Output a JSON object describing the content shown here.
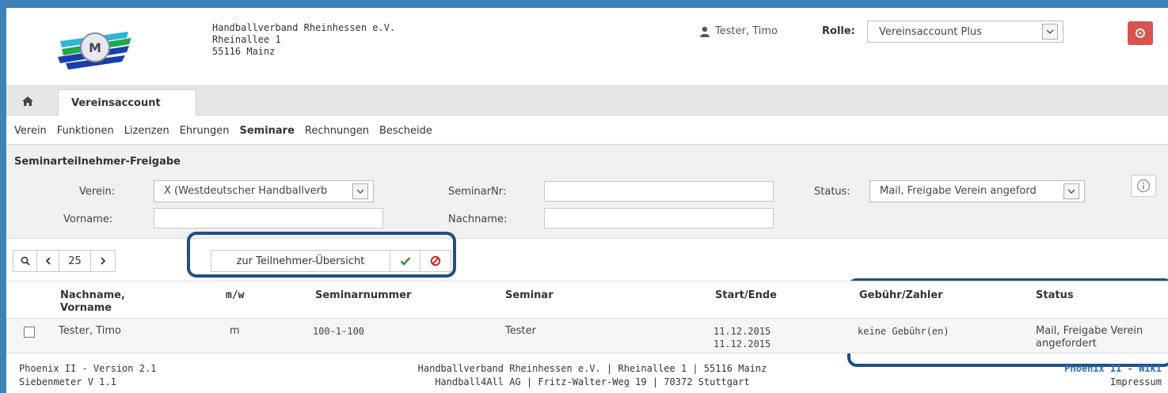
{
  "header": {
    "org_name": "Handballverband Rheinhessen e.V.",
    "org_street": "Rheinallee 1",
    "org_city": "55116 Mainz",
    "user_name": "Tester, Timo",
    "role_label": "Rolle:",
    "role_value": "Vereinsaccount Plus"
  },
  "tabs": {
    "active_label": "Vereinsaccount"
  },
  "submenu": [
    "Verein",
    "Funktionen",
    "Lizenzen",
    "Ehrungen",
    "Seminare",
    "Rechnungen",
    "Bescheide"
  ],
  "submenu_active": "Seminare",
  "filter": {
    "title": "Seminarteilnehmer-Freigabe",
    "verein_label": "Verein:",
    "verein_value": "X (Westdeutscher Handballverb",
    "seminarnr_label": "SeminarNr:",
    "seminarnr_value": "",
    "status_label": "Status:",
    "status_value": "Mail, Freigabe Verein angeford",
    "vorname_label": "Vorname:",
    "vorname_value": "",
    "nachname_label": "Nachname:",
    "nachname_value": ""
  },
  "toolbar": {
    "page_size": "25",
    "overview_label": "zur Teilnehmer-Übersicht"
  },
  "table": {
    "headers": {
      "name": "Nachname, Vorname",
      "name_line1": "Nachname,",
      "name_line2": "Vorname",
      "gender": "m/w",
      "seminarnummer": "Seminarnummer",
      "seminar": "Seminar",
      "start_ende": "Start/Ende",
      "gebuehr": "Gebühr/Zahler",
      "status": "Status"
    },
    "rows": [
      {
        "name": "Tester, Timo",
        "gender": "m",
        "seminarnummer": "100-1-100",
        "seminar": "Tester",
        "start": "11.12.2015",
        "ende": "11.12.2015",
        "gebuehr": "keine Gebühr(en)",
        "status_line1": "Mail, Freigabe Verein",
        "status_line2": "angefordert"
      }
    ]
  },
  "footer": {
    "version": "Phoenix II - Version 2.1",
    "siebenmeter": "Siebenmeter V 1.1",
    "line1": "Handballverband Rheinhessen e.V. | Rheinallee 1 | 55116 Mainz",
    "line2": "Handball4All AG | Fritz-Walter-Weg 19 | 70372 Stuttgart",
    "wiki": "Phoenix II - Wiki",
    "impressum": "Impressum"
  },
  "colors": {
    "frame_bg": "#3d83b7",
    "highlight_border": "#1f4f86",
    "logout_red": "#d9534f",
    "check_green": "#2e9a2e",
    "cancel_red": "#d62020",
    "link_blue": "#2a6eb8"
  },
  "icons": {
    "user": "user-icon",
    "logout": "power-icon",
    "home": "home-icon",
    "info": "info-icon",
    "search": "search-icon",
    "prev": "chevron-left-icon",
    "next": "chevron-right-icon",
    "approve": "check-icon",
    "reject": "cancel-icon"
  }
}
